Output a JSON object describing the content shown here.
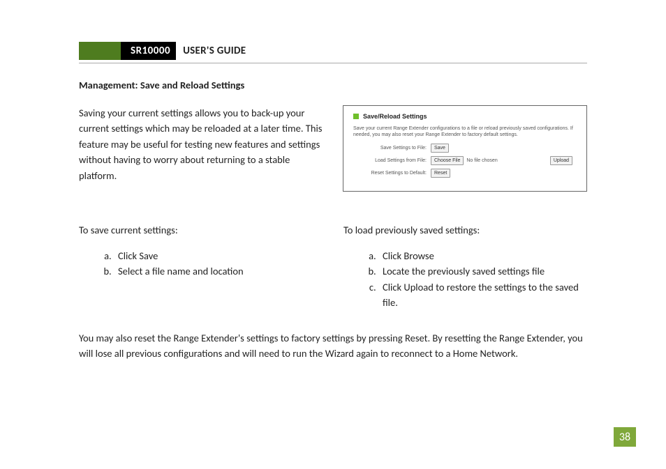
{
  "header": {
    "model": "SR10000",
    "title": "USER'S GUIDE"
  },
  "section_heading": "Management: Save and Reload Settings",
  "intro": "Saving your current settings allows you to back-up your current settings which may be reloaded at a later time. This feature may be useful for testing new features and settings without having to worry about returning to a stable platform.",
  "panel": {
    "title": "Save/Reload Settings",
    "desc": "Save your current Range Extender configurations to a file or reload previously saved configurations. If needed, you may also reset your Range Extender to factory default settings.",
    "row_save_label": "Save Settings to File:",
    "row_save_btn": "Save",
    "row_load_label": "Load Settings from File:",
    "row_load_btn": "Choose File",
    "row_load_status": "No file chosen",
    "row_load_upload": "Upload",
    "row_reset_label": "Reset Settings to Default:",
    "row_reset_btn": "Reset"
  },
  "col_save": {
    "lead": "To save current settings:",
    "items": [
      "Click Save",
      "Select a file name and location"
    ]
  },
  "col_load": {
    "lead": "To load previously saved settings:",
    "items": [
      "Click Browse",
      "Locate the previously saved settings file",
      "Click Upload to restore the settings to the saved file."
    ]
  },
  "footer": "You may also reset the Range Extender's settings to factory settings by pressing Reset.  By resetting the Range Extender, you will lose all previous configurations and will need to run the Wizard again to reconnect to a Home Network.",
  "page_number": "38"
}
